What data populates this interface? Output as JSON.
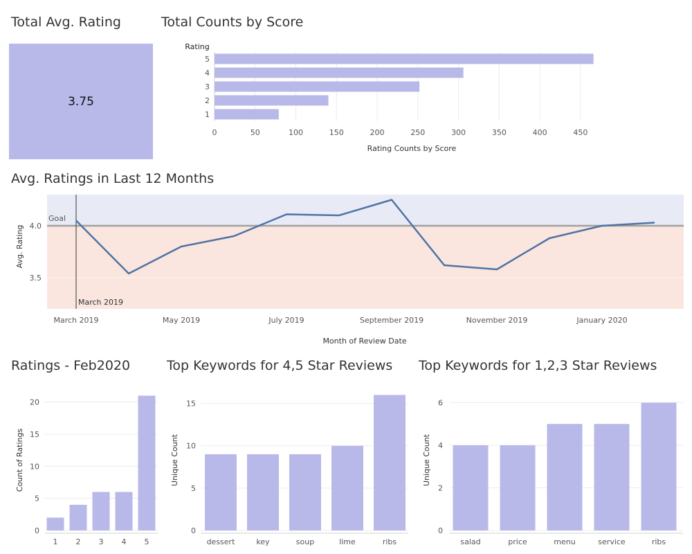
{
  "titles": {
    "total_avg": "Total Avg. Rating",
    "total_counts": "Total Counts by Score",
    "last12": "Avg. Ratings in Last 12 Months",
    "feb2020": "Ratings - Feb2020",
    "top_high": "Top Keywords for 4,5 Star Reviews",
    "top_low": "Top Keywords for 1,2,3 Star Reviews"
  },
  "kpi": {
    "value": "3.75"
  },
  "colors": {
    "bar": "#b8b9e8",
    "line": "#4e73a3",
    "goal_line": "#a0a0a0",
    "band_above": "#e8ebf5",
    "band_below": "#fae6df",
    "grid": "#ececec"
  },
  "chart_data": [
    {
      "id": "counts_by_score",
      "type": "bar",
      "orientation": "horizontal",
      "category_header": "Rating",
      "categories": [
        "5",
        "4",
        "3",
        "2",
        "1"
      ],
      "values": [
        466,
        306,
        252,
        140,
        79
      ],
      "xlabel": "Rating Counts by Score",
      "ticks": [
        0,
        50,
        100,
        150,
        200,
        250,
        300,
        350,
        400,
        450
      ],
      "xlim": [
        0,
        485
      ],
      "grid": true
    },
    {
      "id": "avg_last_12",
      "type": "line",
      "x": [
        "March 2019",
        "April 2019",
        "May 2019",
        "June 2019",
        "July 2019",
        "August 2019",
        "September 2019",
        "October 2019",
        "November 2019",
        "December 2019",
        "January 2020",
        "February 2020"
      ],
      "x_tick_labels": [
        "March 2019",
        "May 2019",
        "July 2019",
        "September 2019",
        "November 2019",
        "January 2020"
      ],
      "values": [
        4.05,
        3.54,
        3.8,
        3.9,
        4.11,
        4.1,
        4.25,
        3.62,
        3.58,
        3.88,
        4.0,
        4.03
      ],
      "ylabel": "Avg. Rating",
      "xlabel": "Month of Review Date",
      "ylim": [
        3.2,
        4.3
      ],
      "yticks": [
        "3.5",
        "4.0"
      ],
      "goal": 4.0,
      "goal_label": "Goal",
      "reference_line_label": "March 2019",
      "grid": true
    },
    {
      "id": "ratings_feb2020",
      "type": "bar",
      "categories": [
        "1",
        "2",
        "3",
        "4",
        "5"
      ],
      "values": [
        2,
        4,
        6,
        6,
        21
      ],
      "ylabel": "Count of Ratings",
      "yticks": [
        0,
        5,
        10,
        15,
        20
      ],
      "ylim": [
        0,
        21.9
      ],
      "grid": true
    },
    {
      "id": "keywords_high",
      "type": "bar",
      "categories": [
        "dessert",
        "key",
        "soup",
        "lime",
        "ribs"
      ],
      "values": [
        9,
        9,
        9,
        10,
        16
      ],
      "ylabel": "Unique Count",
      "yticks": [
        0,
        5,
        10,
        15
      ],
      "ylim": [
        0,
        16.6
      ],
      "grid": true
    },
    {
      "id": "keywords_low",
      "type": "bar",
      "categories": [
        "salad",
        "price",
        "menu",
        "service",
        "ribs"
      ],
      "values": [
        4,
        4,
        5,
        5,
        6
      ],
      "ylabel": "Unique Count",
      "yticks": [
        0,
        2,
        4,
        6
      ],
      "ylim": [
        0,
        6.6
      ],
      "grid": true
    }
  ]
}
